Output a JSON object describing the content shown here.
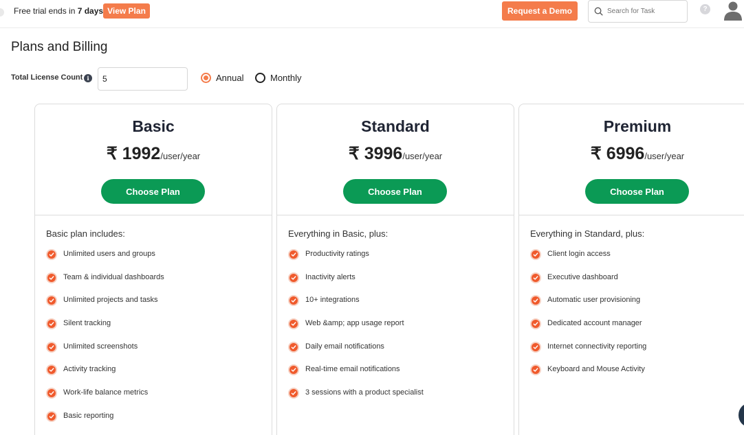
{
  "topbar": {
    "trial_prefix": "Free trial ends in ",
    "trial_days": "7 days!",
    "view_plan_label": "View Plan",
    "request_demo_label": "Request a Demo",
    "search_placeholder": "Search for Task",
    "help_label": "?"
  },
  "page": {
    "title": "Plans and Billing"
  },
  "license": {
    "label": "Total License Count",
    "value": "5",
    "billing_options": [
      "Annual",
      "Monthly"
    ],
    "selected_billing": "Annual"
  },
  "plans": [
    {
      "name": "Basic",
      "price": "₹ 1992",
      "period": "/user/year",
      "button_label": "Choose Plan",
      "includes_label": "Basic plan includes:",
      "features": [
        "Unlimited users and groups",
        "Team & individual dashboards",
        "Unlimited projects and tasks",
        "Silent tracking",
        "Unlimited screenshots",
        "Activity tracking",
        "Work-life balance metrics",
        "Basic reporting"
      ]
    },
    {
      "name": "Standard",
      "price": "₹ 3996",
      "period": "/user/year",
      "button_label": "Choose Plan",
      "includes_label": "Everything in Basic, plus:",
      "features": [
        "Productivity ratings",
        "Inactivity alerts",
        "10+ integrations",
        "Web &amp; app usage report",
        "Daily email notifications",
        "Real-time email notifications",
        "3 sessions with a product specialist"
      ]
    },
    {
      "name": "Premium",
      "price": "₹ 6996",
      "period": "/user/year",
      "button_label": "Choose Plan",
      "includes_label": "Everything in Standard, plus:",
      "features": [
        "Client login access",
        "Executive dashboard",
        "Automatic user provisioning",
        "Dedicated account manager",
        "Internet connectivity reporting",
        "Keyboard and Mouse Activity"
      ]
    }
  ],
  "colors": {
    "accent": "#f47c4b",
    "primary_button": "#0b9a55",
    "check": "#f05a2c"
  }
}
